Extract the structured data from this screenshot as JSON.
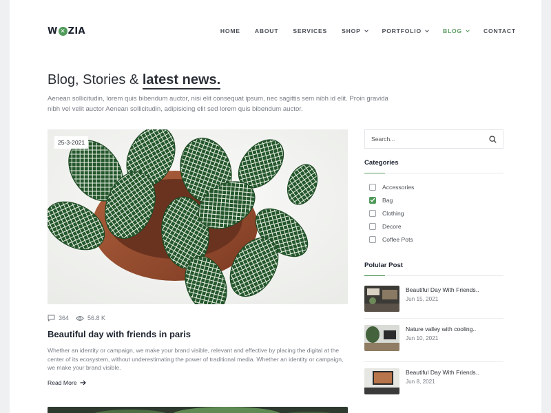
{
  "brand": {
    "logo_pre": "W",
    "logo_mark": "✕",
    "logo_post": "ZIA"
  },
  "nav": [
    {
      "label": "HOME",
      "dropdown": false,
      "active": false
    },
    {
      "label": "ABOUT",
      "dropdown": false,
      "active": false
    },
    {
      "label": "SERVICES",
      "dropdown": false,
      "active": false
    },
    {
      "label": "SHOP",
      "dropdown": true,
      "active": false
    },
    {
      "label": "PORTFOLIO",
      "dropdown": true,
      "active": false
    },
    {
      "label": "BLOG",
      "dropdown": true,
      "active": true
    },
    {
      "label": "CONTACT",
      "dropdown": false,
      "active": false
    }
  ],
  "hero": {
    "title_plain": "Blog, Stories & ",
    "title_highlight": "latest news.",
    "description": "Aenean sollicitudin, lorem quis bibendum auctor, nisi elit consequat ipsum, nec sagittis sem nibh id elit. Proin gravida nibh vel velit auctor Aenean sollicitudin, adipisicing elit sed lorem quis bibendum auctor."
  },
  "post": {
    "date": "25-3-2021",
    "comments": "364",
    "views": "56.8 K",
    "title": "Beautiful day with friends in paris",
    "excerpt": "Whether an identity or campaign, we make your brand visible, relevant and effective by placing the digital at the center of its ecosystem, without underestimating the power of traditional media. Whether an identity or campaign, we make your brand visible.",
    "read_more": "Read More"
  },
  "sidebar": {
    "search_placeholder": "Search...",
    "categories_title": "Categories",
    "categories": [
      {
        "label": "Accessories",
        "checked": false
      },
      {
        "label": "Bag",
        "checked": true
      },
      {
        "label": "Clothing",
        "checked": false
      },
      {
        "label": "Decore",
        "checked": false
      },
      {
        "label": "Coffee Pots",
        "checked": false
      }
    ],
    "popular_title": "Polular Post",
    "popular": [
      {
        "title": "Beautiful Day With Friends..",
        "date": "Jun 15, 2021"
      },
      {
        "title": "Nature valley with cooling..",
        "date": "Jun 10, 2021"
      },
      {
        "title": "Beautiful Day With Friends..",
        "date": "Jun 8, 2021"
      }
    ]
  },
  "colors": {
    "accent": "#5b9a60",
    "text_dark": "#1d2330",
    "muted": "#777c84"
  }
}
